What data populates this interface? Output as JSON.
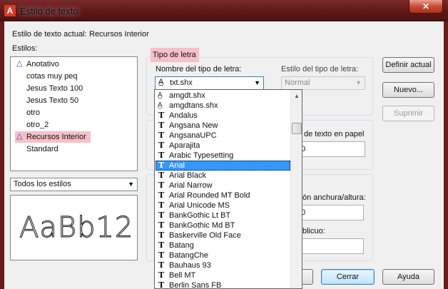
{
  "window": {
    "title": "Estilo de texto",
    "close_label": "✕"
  },
  "current_style": {
    "label": "Estilo de texto actual:",
    "value": "Recursos Interior"
  },
  "styles": {
    "label": "Estilos:",
    "items": [
      {
        "label": "Anotativo",
        "annotative": true
      },
      {
        "label": "cotas muy peq",
        "annotative": false
      },
      {
        "label": "Jesus Texto 100",
        "annotative": false
      },
      {
        "label": "Jesus Texto 50",
        "annotative": false
      },
      {
        "label": "otro",
        "annotative": false
      },
      {
        "label": "otro_2",
        "annotative": false
      },
      {
        "label": "Recursos Interior",
        "annotative": true,
        "selected": true
      },
      {
        "label": "Standard",
        "annotative": false
      }
    ],
    "filter": "Todos los estilos"
  },
  "preview": {
    "text": "AaBb12"
  },
  "font": {
    "group_label": "Tipo de letra",
    "name_label": "Nombre del tipo de letra:",
    "name_value": "txt.shx",
    "style_label": "Estilo del tipo de letra:",
    "style_value": "Normal",
    "dropdown": [
      {
        "label": "amgdt.shx",
        "kind": "shx"
      },
      {
        "label": "amgdtans.shx",
        "kind": "shx"
      },
      {
        "label": "Andalus",
        "kind": "tt"
      },
      {
        "label": "Angsana New",
        "kind": "tt"
      },
      {
        "label": "AngsanaUPC",
        "kind": "tt"
      },
      {
        "label": "Aparajita",
        "kind": "tt"
      },
      {
        "label": "Arabic Typesetting",
        "kind": "tt"
      },
      {
        "label": "Arial",
        "kind": "tt",
        "selected": true
      },
      {
        "label": "Arial Black",
        "kind": "tt"
      },
      {
        "label": "Arial Narrow",
        "kind": "tt"
      },
      {
        "label": "Arial Rounded MT Bold",
        "kind": "tt"
      },
      {
        "label": "Arial Unicode MS",
        "kind": "tt"
      },
      {
        "label": "BankGothic Lt BT",
        "kind": "tt"
      },
      {
        "label": "BankGothic Md BT",
        "kind": "tt"
      },
      {
        "label": "Baskerville Old Face",
        "kind": "tt"
      },
      {
        "label": "Batang",
        "kind": "tt"
      },
      {
        "label": "BatangChe",
        "kind": "tt"
      },
      {
        "label": "Bauhaus 93",
        "kind": "tt"
      },
      {
        "label": "Bell MT",
        "kind": "tt"
      },
      {
        "label": "Berlin Sans FB",
        "kind": "tt"
      }
    ]
  },
  "size": {
    "label_partial": "de texto en papel",
    "value": "0"
  },
  "effects": {
    "width_label_partial": "ón anchura/altura:",
    "width_value": "0",
    "oblique_label_partial": "blicuo:"
  },
  "buttons": {
    "set_current": "Definir actual",
    "new": "Nuevo...",
    "delete": "Suprimir",
    "cancel": "Cerrar",
    "help": "Ayuda"
  },
  "icons": {
    "annotative": "annotative-icon",
    "truetype": "truetype-icon",
    "shx": "shx-font-icon",
    "app": "app-icon"
  },
  "colors": {
    "title_bar": "#5e1818",
    "highlight": "#f6c0c8",
    "selection": "#3399ff"
  }
}
